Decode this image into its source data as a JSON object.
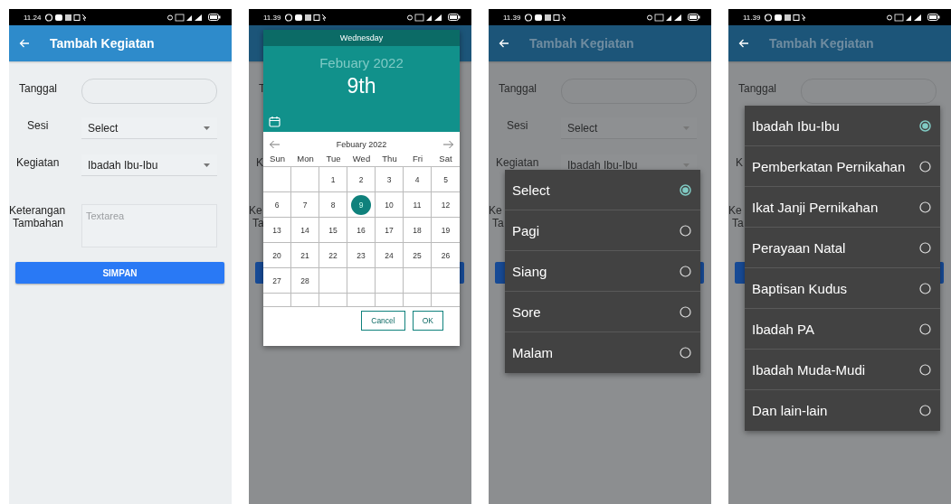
{
  "screens": [
    {
      "status_time": "11.24",
      "app_bar": {
        "title": "Tambah Kegiatan"
      },
      "form": {
        "rows": [
          {
            "label_lines": [
              "Tanggal"
            ],
            "control": {
              "kind": "rounded-field"
            }
          },
          {
            "label_lines": [
              "Sesi"
            ],
            "control": {
              "kind": "dropdown",
              "value": "Select"
            }
          },
          {
            "label_lines": [
              "Kegiatan"
            ],
            "control": {
              "kind": "dropdown",
              "value": "Ibadah Ibu-Ibu"
            }
          },
          {
            "label_lines": [
              "Keterangan",
              "Tambahan"
            ],
            "control": {
              "kind": "textarea",
              "placeholder": "Textarea"
            }
          }
        ],
        "button": {
          "label": "SIMPAN"
        }
      }
    },
    {
      "status_time": "11.39",
      "form": {
        "rows": [
          {
            "label_lines": [
              "T"
            ]
          },
          {
            "covered": true
          },
          {
            "label_lines": [
              "K"
            ]
          },
          {
            "label_lines": [
              "Ke",
              "Ta"
            ]
          }
        ],
        "button": {
          "covered": true
        }
      },
      "dialog": {
        "kind": "date",
        "weekday": "Wednesday",
        "month_year": "Febuary 2022",
        "day": "9th",
        "nav_title": "Febuary 2022",
        "weekdays": [
          "Sun",
          "Mon",
          "Tue",
          "Wed",
          "Thu",
          "Fri",
          "Sat"
        ],
        "weeks": [
          [
            {
              "kind": "blank"
            },
            {
              "kind": "blank"
            },
            {
              "kind": "day",
              "day": "1",
              "selected": false
            },
            {
              "kind": "day",
              "day": "2",
              "selected": false
            },
            {
              "kind": "day",
              "day": "3",
              "selected": false
            },
            {
              "kind": "day",
              "day": "4",
              "selected": false
            },
            {
              "kind": "day",
              "day": "5",
              "selected": false
            }
          ],
          [
            {
              "kind": "day",
              "day": "6",
              "selected": false
            },
            {
              "kind": "day",
              "day": "7",
              "selected": false
            },
            {
              "kind": "day",
              "day": "8",
              "selected": false
            },
            {
              "kind": "day",
              "day": "9",
              "selected": true
            },
            {
              "kind": "day",
              "day": "10",
              "selected": false
            },
            {
              "kind": "day",
              "day": "11",
              "selected": false
            },
            {
              "kind": "day",
              "day": "12",
              "selected": false
            }
          ],
          [
            {
              "kind": "day",
              "day": "13",
              "selected": false
            },
            {
              "kind": "day",
              "day": "14",
              "selected": false
            },
            {
              "kind": "day",
              "day": "15",
              "selected": false
            },
            {
              "kind": "day",
              "day": "16",
              "selected": false
            },
            {
              "kind": "day",
              "day": "17",
              "selected": false
            },
            {
              "kind": "day",
              "day": "18",
              "selected": false
            },
            {
              "kind": "day",
              "day": "19",
              "selected": false
            }
          ],
          [
            {
              "kind": "day",
              "day": "20",
              "selected": false
            },
            {
              "kind": "day",
              "day": "21",
              "selected": false
            },
            {
              "kind": "day",
              "day": "22",
              "selected": false
            },
            {
              "kind": "day",
              "day": "23",
              "selected": false
            },
            {
              "kind": "day",
              "day": "24",
              "selected": false
            },
            {
              "kind": "day",
              "day": "25",
              "selected": false
            },
            {
              "kind": "day",
              "day": "26",
              "selected": false
            }
          ],
          [
            {
              "kind": "day",
              "day": "27",
              "selected": false
            },
            {
              "kind": "day",
              "day": "28",
              "selected": false
            },
            {
              "kind": "blank"
            },
            {
              "kind": "blank"
            },
            {
              "kind": "blank"
            },
            {
              "kind": "blank"
            },
            {
              "kind": "blank"
            }
          ],
          [
            {
              "kind": "blank"
            },
            {
              "kind": "blank"
            },
            {
              "kind": "blank"
            },
            {
              "kind": "blank"
            },
            {
              "kind": "blank"
            },
            {
              "kind": "blank"
            },
            {
              "kind": "blank"
            }
          ]
        ],
        "buttons": [
          "Cancel",
          "OK"
        ]
      }
    },
    {
      "status_time": "11.39",
      "app_bar": {
        "title": "Tambah Kegiatan"
      },
      "form": {
        "rows": [
          {
            "label_lines": [
              "Tanggal"
            ],
            "control": {
              "kind": "rounded-field"
            }
          },
          {
            "label_lines": [
              "Sesi"
            ],
            "control": {
              "kind": "dropdown",
              "value": "Select"
            }
          },
          {
            "label_lines": [
              "Kegiatan"
            ],
            "control": {
              "kind": "dropdown",
              "value": "Ibadah Ibu-Ibu"
            }
          },
          {
            "label_lines": [
              "Ke",
              "Ta"
            ]
          }
        ],
        "button": {
          "covered": true
        }
      },
      "dialog": {
        "kind": "choice",
        "options": [
          {
            "label": "Select",
            "selected": true
          },
          {
            "label": "Pagi",
            "selected": false
          },
          {
            "label": "Siang",
            "selected": false
          },
          {
            "label": "Sore",
            "selected": false
          },
          {
            "label": "Malam",
            "selected": false
          }
        ]
      }
    },
    {
      "status_time": "11.39",
      "app_bar": {
        "title": "Tambah Kegiatan"
      },
      "form": {
        "rows": [
          {
            "label_lines": [
              "Tanggal"
            ],
            "control": {
              "kind": "rounded-field"
            }
          },
          {
            "covered": true
          },
          {
            "label_lines": [
              "K"
            ]
          },
          {
            "label_lines": [
              "Ke",
              "Ta"
            ]
          }
        ],
        "button": {
          "covered": true
        }
      },
      "dialog": {
        "kind": "choice",
        "options": [
          {
            "label": "Ibadah Ibu-Ibu",
            "selected": true
          },
          {
            "label": "Pemberkatan Pernikahan",
            "selected": false
          },
          {
            "label": "Ikat Janji Pernikahan",
            "selected": false
          },
          {
            "label": "Perayaan Natal",
            "selected": false
          },
          {
            "label": "Baptisan Kudus",
            "selected": false
          },
          {
            "label": "Ibadah PA",
            "selected": false
          },
          {
            "label": "Ibadah Muda-Mudi",
            "selected": false
          },
          {
            "label": "Dan lain-lain",
            "selected": false
          }
        ]
      }
    }
  ]
}
